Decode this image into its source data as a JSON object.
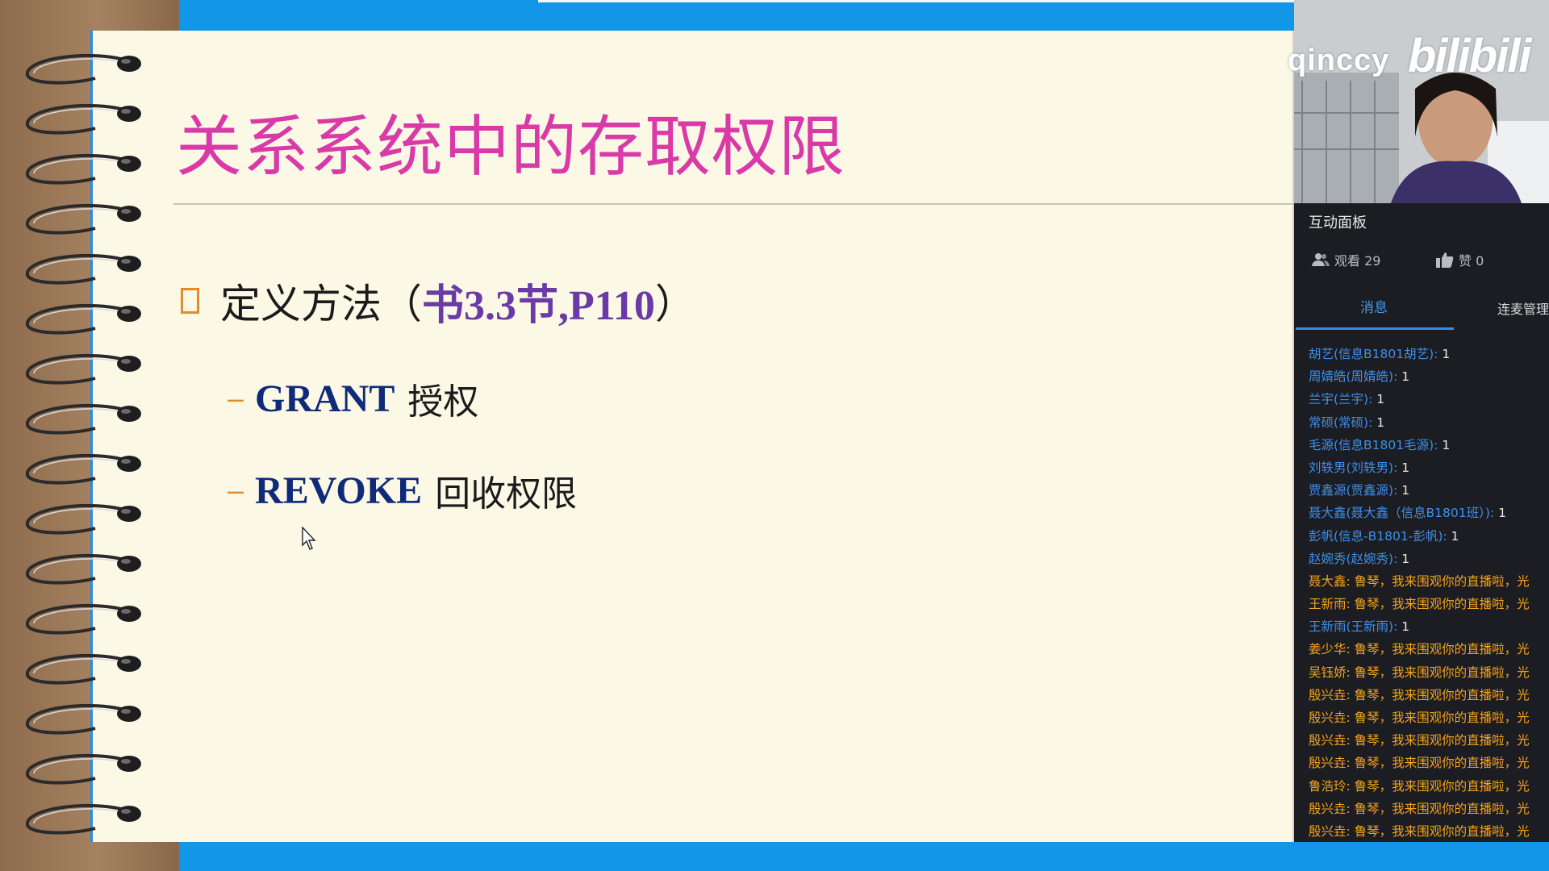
{
  "slide": {
    "title": "关系系统中的存取权限",
    "bullet": {
      "prefix": "定义方法（",
      "reference": "书3.3节,P110",
      "suffix": "）"
    },
    "sub_items": [
      {
        "dash": "–",
        "keyword": "GRANT",
        "text": "授权"
      },
      {
        "dash": "–",
        "keyword": "REVOKE",
        "text": "回收权限"
      }
    ]
  },
  "stream": {
    "username": "qinccy",
    "logo": "bilibili",
    "panel_title": "互动面板",
    "views_label": "观看 29",
    "likes_label": "赞 0",
    "tabs": {
      "messages": "消息",
      "link_mgmt": "连麦管理"
    },
    "chat": [
      {
        "type": "count",
        "who": "胡艺(信息B1801胡艺):",
        "text": "1"
      },
      {
        "type": "count",
        "who": "周婧皓(周婧皓):",
        "text": "1"
      },
      {
        "type": "count",
        "who": "兰宇(兰宇):",
        "text": "1"
      },
      {
        "type": "count",
        "who": "常硕(常硕):",
        "text": "1"
      },
      {
        "type": "count",
        "who": "毛源(信息B1801毛源):",
        "text": "1"
      },
      {
        "type": "count",
        "who": "刘轶男(刘轶男):",
        "text": "1"
      },
      {
        "type": "count",
        "who": "贾鑫源(贾鑫源):",
        "text": "1"
      },
      {
        "type": "count",
        "who": "聂大鑫(聂大鑫（信息B1801班）):",
        "text": "1"
      },
      {
        "type": "count",
        "who": "彭帆(信息-B1801-彭帆):",
        "text": "1"
      },
      {
        "type": "count",
        "who": "赵婉秀(赵婉秀):",
        "text": "1"
      },
      {
        "type": "gift",
        "who": "聂大鑫:",
        "text": "鲁琴，我来围观你的直播啦，光"
      },
      {
        "type": "gift",
        "who": "王新雨:",
        "text": "鲁琴，我来围观你的直播啦，光"
      },
      {
        "type": "count",
        "who": "王新雨(王新雨):",
        "text": "1"
      },
      {
        "type": "gift",
        "who": "姜少华:",
        "text": "鲁琴，我来围观你的直播啦，光"
      },
      {
        "type": "gift",
        "who": "吴钰娇:",
        "text": "鲁琴，我来围观你的直播啦，光"
      },
      {
        "type": "gift",
        "who": "殷兴垚:",
        "text": "鲁琴，我来围观你的直播啦，光"
      },
      {
        "type": "gift",
        "who": "殷兴垚:",
        "text": "鲁琴，我来围观你的直播啦，光"
      },
      {
        "type": "gift",
        "who": "殷兴垚:",
        "text": "鲁琴，我来围观你的直播啦，光"
      },
      {
        "type": "gift",
        "who": "殷兴垚:",
        "text": "鲁琴，我来围观你的直播啦，光"
      },
      {
        "type": "gift",
        "who": "鲁浩玲:",
        "text": "鲁琴，我来围观你的直播啦，光"
      },
      {
        "type": "gift",
        "who": "殷兴垚:",
        "text": "鲁琴，我来围观你的直播啦，光"
      },
      {
        "type": "gift",
        "who": "殷兴垚:",
        "text": "鲁琴，我来围观你的直播啦，光"
      }
    ]
  },
  "colors": {
    "title": "#d93aa8",
    "keyword": "#0e2a78",
    "reference": "#6a3aa6",
    "accent_blue": "#1296e8",
    "chat_name": "#3f8fe8",
    "chat_gift": "#f2a21c"
  }
}
